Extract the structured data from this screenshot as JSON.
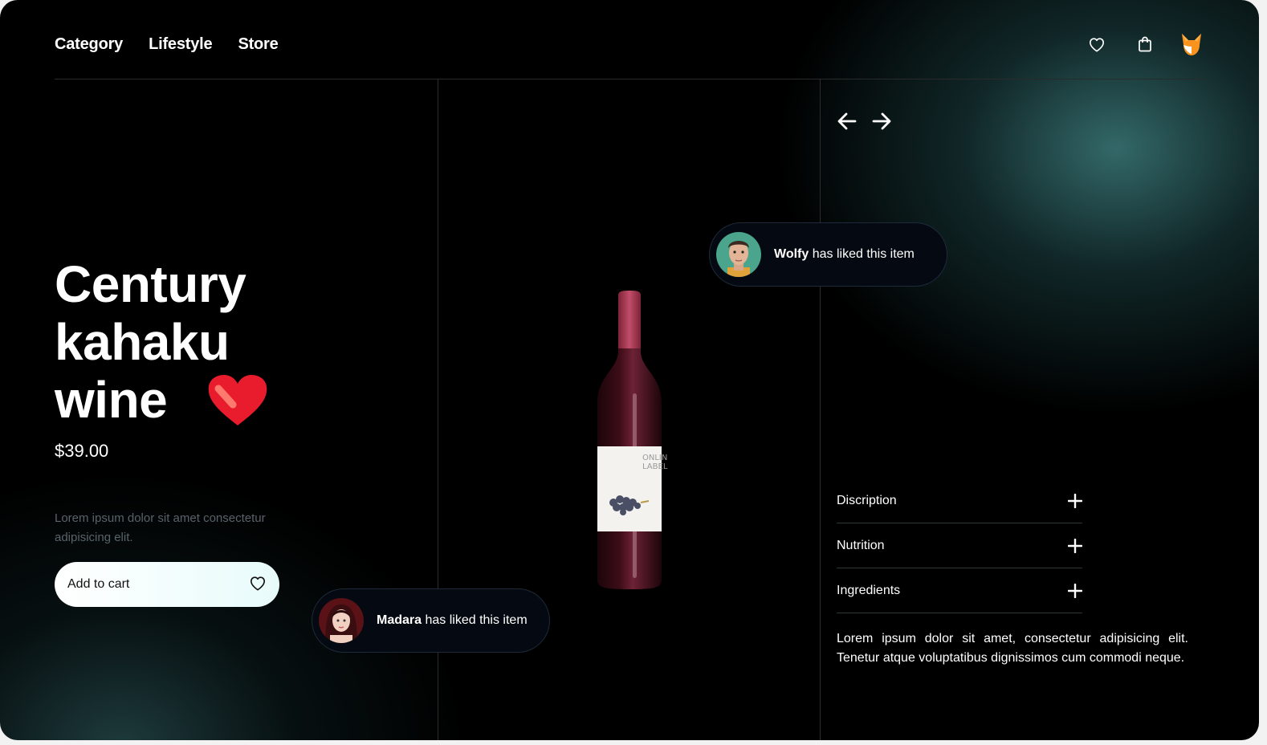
{
  "nav": {
    "items": [
      "Category",
      "Lifestyle",
      "Store"
    ]
  },
  "header": {
    "icons": [
      "heart-icon",
      "shopping-bag-icon",
      "fox-avatar-icon"
    ]
  },
  "product": {
    "title_line1": "Century",
    "title_line2": "kahaku",
    "title_line3": "wine",
    "price": "$39.00",
    "short_description": "Lorem ipsum dolor sit amet consectetur adipisicing elit.",
    "add_to_cart_label": "Add to cart",
    "bottle_label_line1": "ONLINE",
    "bottle_label_line2": "LABEL"
  },
  "likes": [
    {
      "name": "Wolfy",
      "text": "has liked this item"
    },
    {
      "name": "Madara",
      "text": "has liked this item"
    }
  ],
  "accordion": [
    {
      "label": "Discription"
    },
    {
      "label": "Nutrition"
    },
    {
      "label": "Ingredients"
    }
  ],
  "long_description": "Lorem ipsum dolor sit amet, consectetur adipisicing elit. Tenetur atque voluptatibus dignissimos cum commodi neque.",
  "colors": {
    "background": "#000000",
    "accent_glow": "#2f6a6a",
    "heart": "#e81c2c",
    "bottle_cap": "#b1405e"
  }
}
